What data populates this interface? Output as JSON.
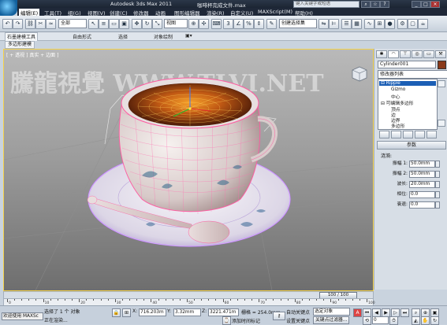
{
  "window": {
    "title_left": "Autodesk 3ds Max  2011",
    "title_file": "咖啡杯完成文件.max",
    "help_placeholder": "键入关键字或短语"
  },
  "menu": [
    "编辑(E)",
    "工具(T)",
    "组(G)",
    "视图(V)",
    "创建(C)",
    "修改器",
    "动画",
    "图形编辑器",
    "渲染(R)",
    "自定义(U)",
    "MAXScript(M)",
    "帮助(H)"
  ],
  "toolbar": {
    "filter": "全部",
    "refcoord": "视图",
    "selset": "创建选择集"
  },
  "ribbon": {
    "tabs": [
      "石墨建模工具",
      "自由形式",
      "选择",
      "对象绘制"
    ],
    "subtab": "多边形建模"
  },
  "viewport": {
    "label": "[ + 透视 ] 真实 + 边面 ]",
    "watermark": "騰龍視覺 WWW.TLVI.NET"
  },
  "command_panel": {
    "object_name": "Cylinder001",
    "object_color": "#8a3a1a",
    "modifier_list": "修改器列表",
    "stack": [
      {
        "label": "⊟ Ripple",
        "selected": true
      },
      {
        "label": "Gizmo",
        "selected": false
      },
      {
        "label": "中心",
        "selected": false
      },
      {
        "label": "⊟ 可编辑多边形",
        "selected": false
      },
      {
        "label": "顶点",
        "selected": false
      },
      {
        "label": "边",
        "selected": false
      },
      {
        "label": "边界",
        "selected": false
      },
      {
        "label": "多边形",
        "selected": false
      }
    ],
    "params_header": "参数",
    "ripple_group": "涟漪:",
    "params": [
      {
        "label": "振幅 1:",
        "value": "50.0mm"
      },
      {
        "label": "振幅 2:",
        "value": "50.0mm"
      },
      {
        "label": "波长:",
        "value": "20.0mm"
      },
      {
        "label": "相位:",
        "value": "0.0"
      },
      {
        "label": "衰退:",
        "value": "0.0"
      }
    ]
  },
  "timeline": {
    "frame_label": "0 / 100",
    "frame_counter": "100 / 100",
    "ticks": [
      "0",
      "10",
      "20",
      "30",
      "40",
      "50",
      "60",
      "70",
      "80",
      "90",
      "100"
    ]
  },
  "status": {
    "welcome": "欢迎使用  MAXSc",
    "selected": "选择了 1 个 对象",
    "prompt": "正在渲染...",
    "x_label": "X:",
    "x_value": "716.203m",
    "y_label": "Y:",
    "y_value": "3.32mm",
    "z_label": "Z:",
    "z_value": "3221.471m",
    "grid": "栅格 = 254.0mm",
    "add_time_tag": "添加时间标记",
    "auto_key": "自动关键点",
    "selected_obj": "选定对象",
    "set_key": "设置关键点",
    "key_filters": "关键点过滤器..."
  },
  "colors": {
    "selection_gizmo": "#f4d24a",
    "selected_mesh": "#ff5aa0",
    "modifier_highlight": "#1c5fb5"
  }
}
